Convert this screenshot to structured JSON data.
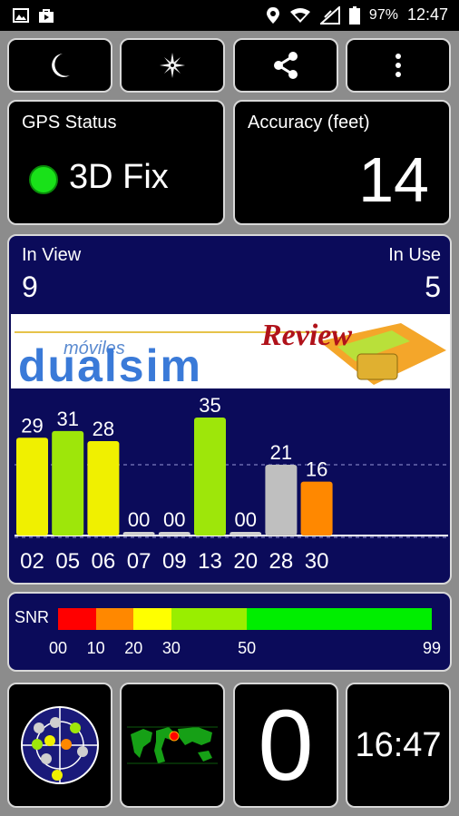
{
  "status_bar": {
    "battery": "97%",
    "time": "12:47",
    "icons_left": [
      "image-icon",
      "store-bag-icon"
    ],
    "icons_right": [
      "location-pin-icon",
      "wifi-icon",
      "signal-icon",
      "battery-icon"
    ]
  },
  "toolbar": {
    "buttons": [
      "moon-icon",
      "compass-star-icon",
      "share-icon",
      "more-vert-icon"
    ]
  },
  "gps_status": {
    "title": "GPS Status",
    "fix": "3D Fix",
    "fix_color": "#19e119"
  },
  "accuracy": {
    "title": "Accuracy (feet)",
    "value": "14"
  },
  "satellites": {
    "in_view_label": "In View",
    "in_view": "9",
    "in_use_label": "In Use",
    "in_use": "5"
  },
  "banner": {
    "brand_small": "móviles",
    "brand": "dualsim",
    "brand_accent": "Review"
  },
  "chart_data": {
    "type": "bar",
    "categories": [
      "02",
      "05",
      "06",
      "07",
      "09",
      "13",
      "20",
      "28",
      "30"
    ],
    "values": [
      29,
      31,
      28,
      0,
      0,
      35,
      0,
      21,
      16
    ],
    "value_labels": [
      "29",
      "31",
      "28",
      "00",
      "00",
      "35",
      "00",
      "21",
      "16"
    ],
    "colors": [
      "#f0f000",
      "#9ee60a",
      "#f0f000",
      "#cfcfcf",
      "#cfcfcf",
      "#9ee60a",
      "#cfcfcf",
      "#bfbfbf",
      "#ff8800"
    ],
    "ylim": [
      0,
      35
    ]
  },
  "snr": {
    "label": "SNR",
    "segments": [
      {
        "from": 0,
        "to": 10,
        "color": "#ff0000"
      },
      {
        "from": 10,
        "to": 20,
        "color": "#ff8800"
      },
      {
        "from": 20,
        "to": 30,
        "color": "#ffff00"
      },
      {
        "from": 30,
        "to": 50,
        "color": "#99ee00"
      },
      {
        "from": 50,
        "to": 99,
        "color": "#00ee00"
      }
    ],
    "ticks": [
      "00",
      "10",
      "20",
      "30",
      "50",
      "99"
    ]
  },
  "bottom": {
    "radar_icon": "satellite-radar-icon",
    "map_icon": "world-map-icon",
    "counter": "0",
    "clock": "16:47"
  }
}
